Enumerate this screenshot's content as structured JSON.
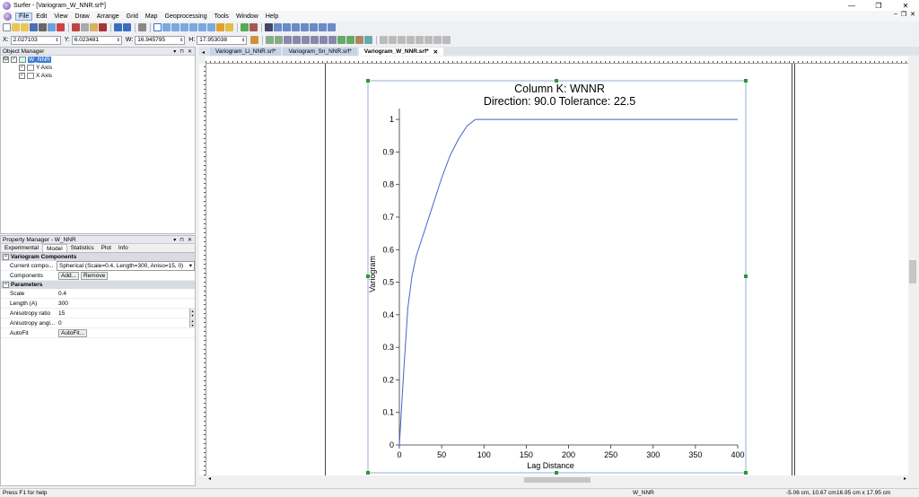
{
  "window": {
    "title": "Surfer - [Variogram_W_NNR.srf*]",
    "min": "—",
    "max": "❐",
    "close": "✕"
  },
  "menu": [
    "File",
    "Edit",
    "View",
    "Draw",
    "Arrange",
    "Grid",
    "Map",
    "Geoprocessing",
    "Tools",
    "Window",
    "Help"
  ],
  "mdi_controls": {
    "min": "–",
    "restore": "❐",
    "close": "✕"
  },
  "coords": [
    {
      "label": "X:",
      "value": "2.027103"
    },
    {
      "label": "Y:",
      "value": "6.023481"
    },
    {
      "label": "W:",
      "value": "16.945795"
    },
    {
      "label": "H:",
      "value": "17.953038"
    }
  ],
  "object_manager": {
    "title": "Object Manager",
    "controls": [
      "▾",
      "⊓",
      "✕"
    ],
    "root": {
      "expander": "⊟",
      "label": "W_NNR"
    },
    "children": [
      {
        "label": "Y Axis"
      },
      {
        "label": "X Axis"
      }
    ]
  },
  "property_manager": {
    "title": "Property Manager - W_NNR",
    "controls": [
      "▾",
      "⊓",
      "✕"
    ],
    "tabs": [
      "Experimental",
      "Model",
      "Statistics",
      "Plot",
      "Info"
    ],
    "active_tab": "Model",
    "sections": {
      "variogram": {
        "title": "Variogram Components",
        "current_label": "Current compo...",
        "current_value": "Spherical (Scale=0.4, Length=300, Aniso=15, 0)",
        "components_label": "Components",
        "add_btn": "Add...",
        "remove_btn": "Remove"
      },
      "parameters": {
        "title": "Parameters",
        "rows": [
          {
            "k": "Scale",
            "v": "0.4"
          },
          {
            "k": "Length (A)",
            "v": "300"
          },
          {
            "k": "Anisotropy ratio",
            "v": "15"
          },
          {
            "k": "Anisotropy angl...",
            "v": "0"
          }
        ],
        "autofit_label": "AutoFit",
        "autofit_btn": "AutoFit..."
      }
    }
  },
  "doc_tabs": [
    {
      "label": "Variogram_Li_NNR.srf*",
      "active": false
    },
    {
      "label": "Variogram_Sn_NNR.srf*",
      "active": false
    },
    {
      "label": "Variogram_W_NNR.srf*",
      "active": true
    }
  ],
  "status": {
    "help": "Press F1 for help",
    "object": "W_NNR",
    "cursor": "-5.06 cm, 10.67 cm",
    "size": "16.95 cm x 17.95 cm"
  },
  "chart_data": {
    "type": "line",
    "title": "Column K:  WNNR",
    "subtitle": "Direction: 90.0   Tolerance: 22.5",
    "xlabel": "Lag Distance",
    "ylabel": "Variogram",
    "xlim": [
      0,
      400
    ],
    "ylim": [
      0,
      1.05
    ],
    "xticks": [
      0,
      50,
      100,
      150,
      200,
      250,
      300,
      350,
      400
    ],
    "yticks": [
      0,
      0.1,
      0.2,
      0.3,
      0.4,
      0.5,
      0.6,
      0.7,
      0.8,
      0.9,
      1
    ],
    "model": {
      "kind": "spherical",
      "scale": 0.4,
      "length": 300,
      "aniso_ratio": 15,
      "aniso_angle": 0
    },
    "series": [
      {
        "x": [
          0,
          5,
          10,
          15,
          20,
          30,
          40,
          50,
          60,
          70,
          80,
          90,
          100,
          400
        ],
        "y": [
          0,
          0.22,
          0.42,
          0.52,
          0.58,
          0.66,
          0.74,
          0.82,
          0.89,
          0.94,
          0.98,
          1.0,
          1.0,
          1.0
        ]
      }
    ],
    "color": "#4a5fd0"
  }
}
